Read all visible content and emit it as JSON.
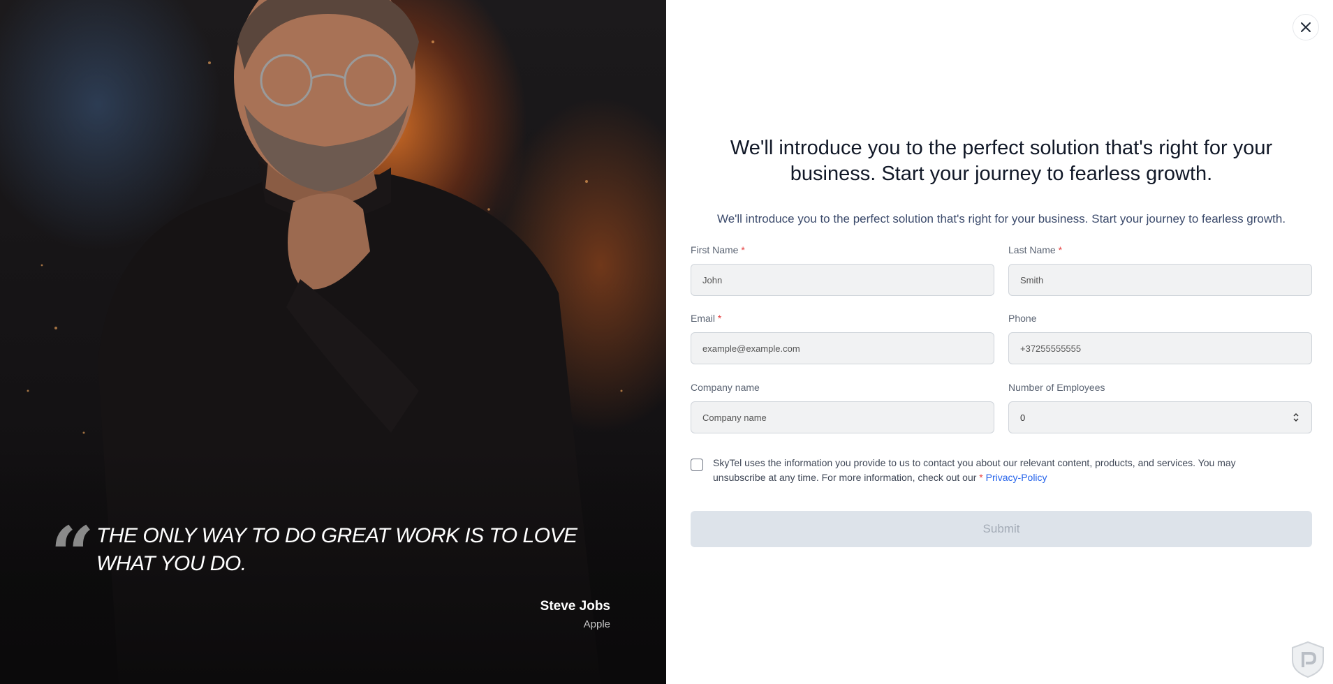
{
  "testimonial": {
    "quote": "THE ONLY WAY TO DO GREAT WORK IS TO LOVE WHAT YOU DO.",
    "author": "Steve Jobs",
    "company": "Apple"
  },
  "form": {
    "headline": "We'll introduce you to the perfect solution that's right for your business. Start your journey to fearless growth.",
    "subline": "We'll introduce you to the perfect solution that's right for your business. Start your journey to fearless growth.",
    "required_marker": "*",
    "fields": {
      "first_name": {
        "label": "First Name",
        "placeholder": "John"
      },
      "last_name": {
        "label": "Last Name",
        "placeholder": "Smith"
      },
      "email": {
        "label": "Email",
        "placeholder": "example@example.com"
      },
      "phone": {
        "label": "Phone",
        "placeholder": "+37255555555"
      },
      "company": {
        "label": "Company name",
        "placeholder": "Company name"
      },
      "employees": {
        "label": "Number of Employees",
        "value": "0"
      }
    },
    "consent_text": "SkyTel uses the information you provide to us to contact you about our relevant content, products, and services. You may unsubscribe at any time. For more information, check out our",
    "privacy_link": "Privacy-Policy",
    "submit_label": "Submit"
  },
  "colors": {
    "accent_link": "#2563eb",
    "required": "#e53e3e",
    "submit_disabled_bg": "#dde3ea"
  },
  "icons": {
    "close": "close-icon",
    "quote": "quote-icon",
    "stepper": "stepper-icon",
    "logo": "shield-logo-icon"
  }
}
